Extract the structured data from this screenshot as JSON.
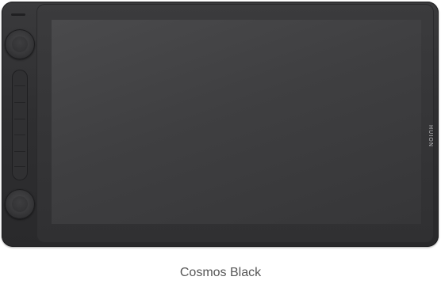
{
  "product": {
    "brand_logo_text": "HUION",
    "caption": "Cosmos Black"
  },
  "colors": {
    "body": "#2f2f31",
    "screen": "#3f3f41",
    "caption_text": "#555555",
    "background": "#ffffff"
  },
  "icons": [
    "dial-icon",
    "express-key-strip"
  ]
}
